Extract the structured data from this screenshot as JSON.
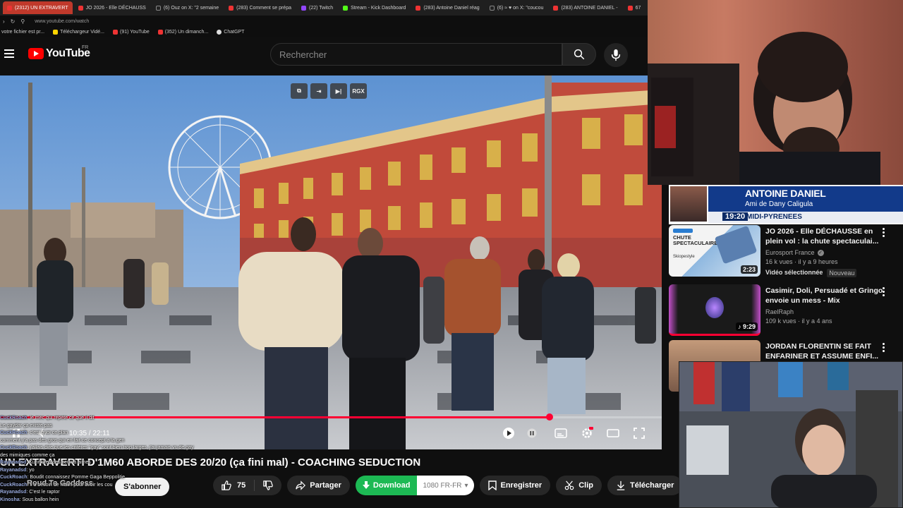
{
  "browser": {
    "tabs": [
      {
        "label": "(2312) UN EXTRAVERT",
        "icon": "youtube-favicon",
        "active": true
      },
      {
        "label": "JO 2026 - Elle DÉCHAUSS",
        "icon": "youtube-favicon"
      },
      {
        "label": "(6) Ouz on X: \"2 semaine",
        "icon": "x-favicon"
      },
      {
        "label": "(283) Comment se prépa",
        "icon": "youtube-favicon"
      },
      {
        "label": "(22) Twitch",
        "icon": "twitch-favicon"
      },
      {
        "label": "Stream - Kick Dashboard",
        "icon": "kick-favicon"
      },
      {
        "label": "(283) Antoine Daniel réag",
        "icon": "youtube-favicon"
      },
      {
        "label": "(6) ≈ ♥ on X: \"coucou",
        "icon": "x-favicon"
      },
      {
        "label": "(283) ANTOINE DANIEL -",
        "icon": "youtube-favicon"
      },
      {
        "label": "67",
        "icon": "youtube-favicon"
      }
    ],
    "url": "www.youtube.com/watch",
    "bookmarks": [
      {
        "label": "votre fichier est pr...",
        "icon": "none"
      },
      {
        "label": "Téléchargeur Vidé...",
        "icon": "download-favicon"
      },
      {
        "label": "(91) YouTube",
        "icon": "youtube-favicon"
      },
      {
        "label": "(352) Un dimanch...",
        "icon": "youtube-favicon"
      },
      {
        "label": "ChatGPT",
        "icon": "chatgpt-favicon"
      }
    ]
  },
  "youtube": {
    "logo_text": "YouTube",
    "country": "FR",
    "search_placeholder": "Rechercher"
  },
  "player": {
    "overlay_label": "RGX",
    "timecode": "10:35 / 22:11",
    "progress": 0.83
  },
  "chat": [
    {
      "user": "CuckRoach",
      "text": "le mec qui répète ce que il dit"
    },
    {
      "user": "",
      "text": "Le gaydar ça existe pas"
    },
    {
      "user": "CuckRoach",
      "text": "c'est quoi ce plan"
    },
    {
      "user": "",
      "text": "comment y'a pas des gros qui en fait ce concept à la gen"
    },
    {
      "user": "CuckRoach",
      "text": "j'allais dire que les critères \"gay\" sont bien trop larges, j'ai jamais vu de gay"
    },
    {
      "user": "",
      "text": "des mimiques comme ça"
    },
    {
      "user": "Rayanadsd",
      "text": "Kunrikken des ceux à aimes"
    },
    {
      "user": "Rayanadsd",
      "text": "yo"
    },
    {
      "user": "CuckRoach",
      "text": "Boudit connaissez Pomme Gaga Beppolitie"
    },
    {
      "user": "CuckRoach",
      "text": "il a besoin de ritalin pour avoir les cou"
    },
    {
      "user": "Rayanadsd",
      "text": "C'est le raptor"
    },
    {
      "user": "Kinosha",
      "text": "Sous ballon hein"
    }
  ],
  "video": {
    "title": "UN EXTRAVERTI D'1M60 ABORDE DES 20/20 (ça fini mal) - COACHING SEDUCTION",
    "channel": "Roud To Goddess",
    "subscribe": "S'abonner",
    "likes": "75",
    "share": "Partager",
    "download": "Download",
    "quality": "1080 FR-FR",
    "save": "Enregistrer",
    "clip": "Clip",
    "telecharger": "Télécharger"
  },
  "banner": {
    "name": "ANTOINE DANIEL",
    "subtitle": "Ami de Dany Caligula",
    "time": "19:20",
    "region": "MIDI-PYRENEES"
  },
  "recommendations": [
    {
      "title": "JO 2026 - Elle DÉCHAUSSE en plein vol : la chute spectaculai...",
      "channel": "Eurosport France",
      "verified": true,
      "meta": "16 k vues · il y a 9 heures",
      "badge": "Vidéo sélectionnée",
      "badge_new": "Nouveau",
      "duration": "2:23",
      "thumb_text": "CHUTE SPECTACULAIRE",
      "thumb_sub": "Skiopestyle"
    },
    {
      "title": "Casimir, Doli, Persuadé et Gringo envoie un mess - Mix",
      "channel": "RaelRaph",
      "verified": false,
      "meta": "109 k vues · il y a 4 ans",
      "duration": "9:29"
    },
    {
      "title": "JORDAN FLORENTIN SE FAIT ENFARINER ET ASSUME ENFI...",
      "channel": "",
      "meta": ""
    }
  ],
  "colors": {
    "youtube_red": "#ff0000",
    "progress_red": "#ff0033",
    "download_green": "#1db954",
    "active_tab": "#c0392b"
  }
}
